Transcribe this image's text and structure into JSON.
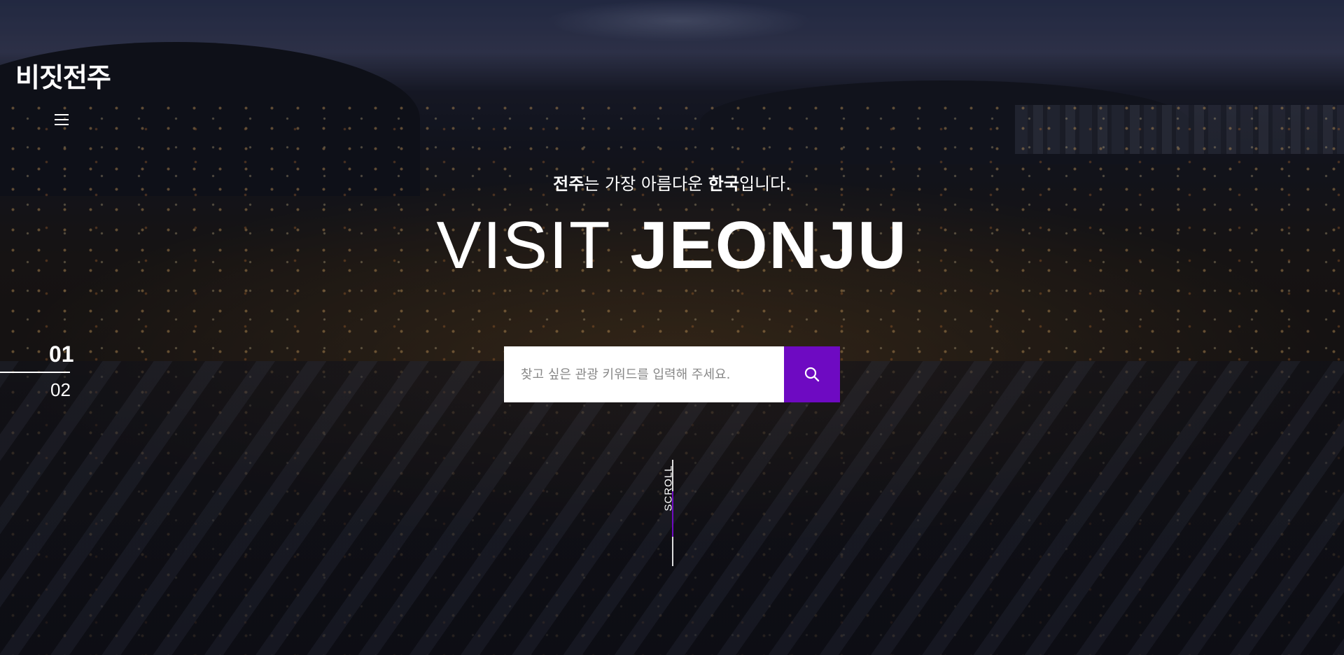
{
  "brand": {
    "logo_text": "비짓전주"
  },
  "header": {
    "menu_icon": "hamburger-icon"
  },
  "pager": {
    "current": "01",
    "next": "02"
  },
  "hero": {
    "subtitle": {
      "part1_bold": "전주",
      "part2": "는 가장 아름다운 ",
      "part3_bold": "한국",
      "part4": "입니다."
    },
    "title_light": "VISIT",
    "title_bold": "JEONJU"
  },
  "search": {
    "placeholder": "찾고 싶은 관광 키워드를 입력해 주세요.",
    "button_icon": "search-icon",
    "button_color": "#6e0ac2"
  },
  "scroll": {
    "label": "SCROLL"
  },
  "colors": {
    "accent": "#6e0ac2",
    "text": "#ffffff"
  }
}
